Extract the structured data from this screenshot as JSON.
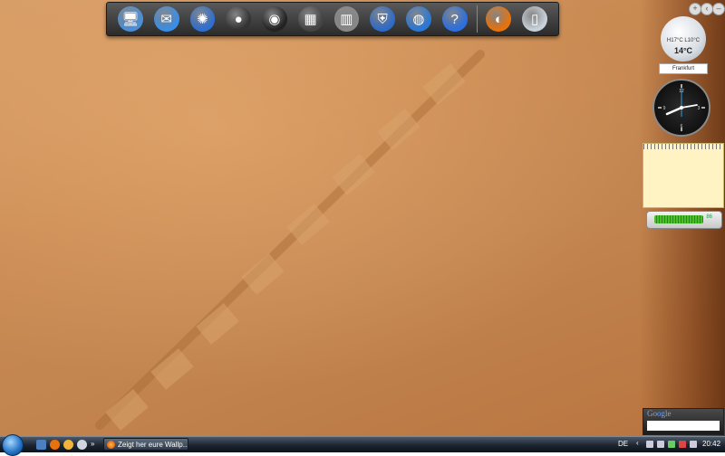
{
  "dock": {
    "items": [
      {
        "name": "computer-icon",
        "color": "#4a8fd8",
        "glyph": "🖥"
      },
      {
        "name": "mail-icon",
        "color": "#3a8ee8",
        "glyph": "✉"
      },
      {
        "name": "network-icon",
        "color": "#2f6fd0",
        "glyph": "✺"
      },
      {
        "name": "camera-icon",
        "color": "#333333",
        "glyph": "●"
      },
      {
        "name": "speaker-icon",
        "color": "#222222",
        "glyph": "◉"
      },
      {
        "name": "clapperboard-icon",
        "color": "#444444",
        "glyph": "▦"
      },
      {
        "name": "trash-can-icon",
        "color": "#888888",
        "glyph": "▥"
      },
      {
        "name": "security-shield-icon",
        "color": "#2e6bc8",
        "glyph": "⛨"
      },
      {
        "name": "internet-globe-icon",
        "color": "#2a78d6",
        "glyph": "◍"
      },
      {
        "name": "help-icon",
        "color": "#2b6fe0",
        "glyph": "?"
      },
      {
        "name": "firefox-icon",
        "color": "#e8720c",
        "glyph": "◐"
      },
      {
        "name": "recycle-bin-icon",
        "color": "#c9d2da",
        "glyph": "▯"
      }
    ]
  },
  "gadgets": {
    "weather": {
      "range": "H17°C L10°C",
      "temp": "14°C",
      "city": "Frankfurt"
    },
    "clock": {
      "time": "20:42"
    },
    "battery": {
      "level": 0.9,
      "label": "86"
    },
    "google": {
      "logo": "Google"
    }
  },
  "taskbar": {
    "task_label": "Zeigt her eure Wallp...",
    "language": "DE",
    "time": "20:42"
  }
}
